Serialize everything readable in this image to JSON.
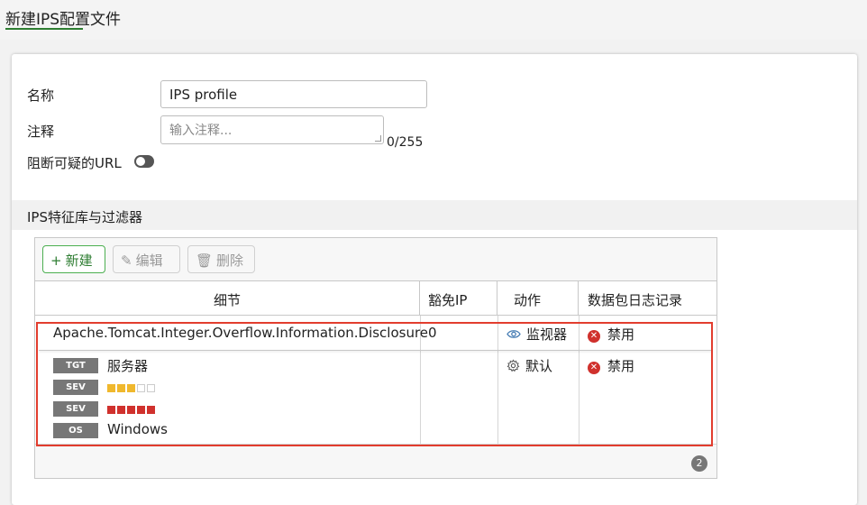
{
  "page": {
    "title": "新建IPS配置文件"
  },
  "form": {
    "name_label": "名称",
    "name_value": "IPS profile",
    "comment_label": "注释",
    "comment_placeholder": "输入注释...",
    "comment_count": "0/255",
    "block_url_label": "阻断可疑的URL",
    "block_url_enabled": false
  },
  "section": {
    "title": "IPS特征库与过滤器"
  },
  "toolbar": {
    "new_label": "新建",
    "edit_label": "编辑",
    "delete_label": "删除"
  },
  "table": {
    "headers": [
      "细节",
      "豁免IP",
      "动作",
      "数据包日志记录"
    ],
    "rows": [
      {
        "detail": "Apache.Tomcat.Integer.Overflow.Information.Disclosure",
        "exempt_ip": "0",
        "action": "监视器",
        "action_icon": "eye-icon",
        "packet_log": "禁用"
      },
      {
        "tags": [
          {
            "tag": "TGT",
            "value": "服务器"
          },
          {
            "tag": "SEV",
            "level": 3,
            "max": 5,
            "color": "#f0b82d"
          },
          {
            "tag": "SEV",
            "level": 5,
            "max": 5,
            "color": "#d0312d"
          },
          {
            "tag": "OS",
            "value": "Windows"
          }
        ],
        "action": "默认",
        "action_icon": "gear-icon",
        "packet_log": "禁用"
      }
    ],
    "page_count": "2"
  },
  "colors": {
    "accent": "#2e7d32",
    "highlight": "#e23d2e",
    "disabled_icon": "#d0312d"
  }
}
